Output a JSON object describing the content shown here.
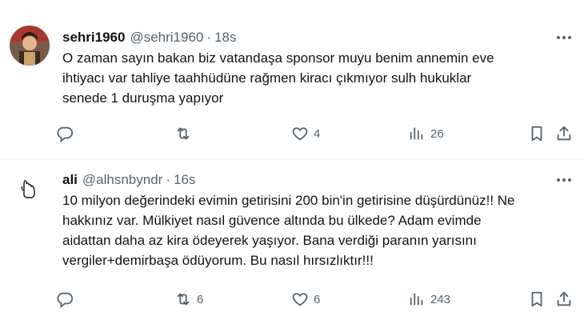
{
  "tweets": [
    {
      "name": "sehri1960",
      "handle": "@sehri1960",
      "separator": "·",
      "time": "18s",
      "text": "O zaman sayın bakan biz vatandaşa sponsor muyu benim annemin eve\nihtiyacı var tahliye taahhüdüne rağmen kiracı çıkmıyor sulh hukuklar\nsenede 1 duruşma yapıyor",
      "replies": "",
      "retweets": "",
      "likes": "4",
      "views": "26"
    },
    {
      "name": "ali",
      "handle": "@alhsnbyndr",
      "separator": "·",
      "time": "16s",
      "text": "10 milyon değerindeki evimin getirisini 200 bin'in getirisine düşürdünüz!! Ne\nhakkınız var. Mülkiyet nasıl güvence altında bu ülkede? Adam evimde\naidattan daha az kira ödeyerek yaşıyor. Bana verdiği paranın yarısını\nvergiler+demirbaşa ödüyorum. Bu nasıl hırsızlıktır!!!",
      "replies": "",
      "retweets": "6",
      "likes": "6",
      "views": "243"
    }
  ],
  "icons": {
    "reply": "reply-icon",
    "retweet": "retweet-icon",
    "like": "heart-icon",
    "views": "views-icon",
    "bookmark": "bookmark-icon",
    "share": "share-icon",
    "more": "more-icon"
  },
  "colors": {
    "text": "#0f1419",
    "secondary": "#536471",
    "divider": "#eff3f4"
  }
}
